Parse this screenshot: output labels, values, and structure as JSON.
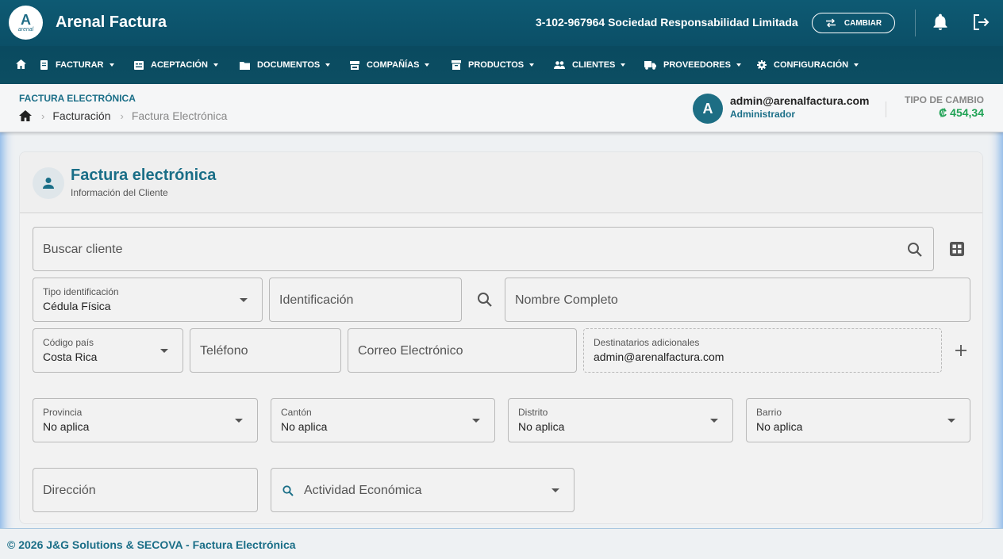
{
  "app": {
    "title": "Arenal Factura",
    "logo_letter": "A",
    "logo_text": "arenal"
  },
  "topbar": {
    "company": "3-102-967964 Sociedad Responsabilidad Limitada",
    "switch_label": "CAMBIAR"
  },
  "nav": {
    "items": [
      {
        "label": "FACTURAR",
        "icon": "receipt-icon"
      },
      {
        "label": "ACEPTACIÓN",
        "icon": "inbox-icon"
      },
      {
        "label": "DOCUMENTOS",
        "icon": "folder-icon"
      },
      {
        "label": "COMPAÑÍAS",
        "icon": "store-icon"
      },
      {
        "label": "PRODUCTOS",
        "icon": "archive-icon"
      },
      {
        "label": "CLIENTES",
        "icon": "people-icon"
      },
      {
        "label": "PROVEEDORES",
        "icon": "truck-icon"
      },
      {
        "label": "CONFIGURACIÓN",
        "icon": "gear-icon"
      }
    ]
  },
  "subheader": {
    "page_title": "FACTURA ELECTRÓNICA",
    "breadcrumb": [
      "Facturación",
      "Factura Electrónica"
    ],
    "user": {
      "initial": "A",
      "email": "admin@arenalfactura.com",
      "role": "Administrador"
    },
    "exchange": {
      "label": "TIPO DE CAMBIO",
      "value": "₡ 454,34"
    }
  },
  "card": {
    "title": "Factura electrónica",
    "subtitle": "Información del Cliente"
  },
  "form": {
    "search_client": "Buscar cliente",
    "id_type": {
      "label": "Tipo identificación",
      "value": "Cédula Física"
    },
    "identification": "Identificación",
    "full_name": "Nombre Completo",
    "country_code": {
      "label": "Código país",
      "value": "Costa Rica"
    },
    "phone": "Teléfono",
    "email": "Correo Electrónico",
    "extra_recipients": {
      "label": "Destinatarios adicionales",
      "value": "admin@arenalfactura.com"
    },
    "province": {
      "label": "Provincia",
      "value": "No aplica"
    },
    "canton": {
      "label": "Cantón",
      "value": "No aplica"
    },
    "district": {
      "label": "Distrito",
      "value": "No aplica"
    },
    "neighborhood": {
      "label": "Barrio",
      "value": "No aplica"
    },
    "address": "Dirección",
    "activity": "Actividad Económica"
  },
  "footer": {
    "copyright": "© 2026 J&G Solutions & SECOVA - Factura Electrónica"
  },
  "colors": {
    "primary": "#1a6e87",
    "topbar": "#0e5a73",
    "accent_green": "#1fa255"
  }
}
